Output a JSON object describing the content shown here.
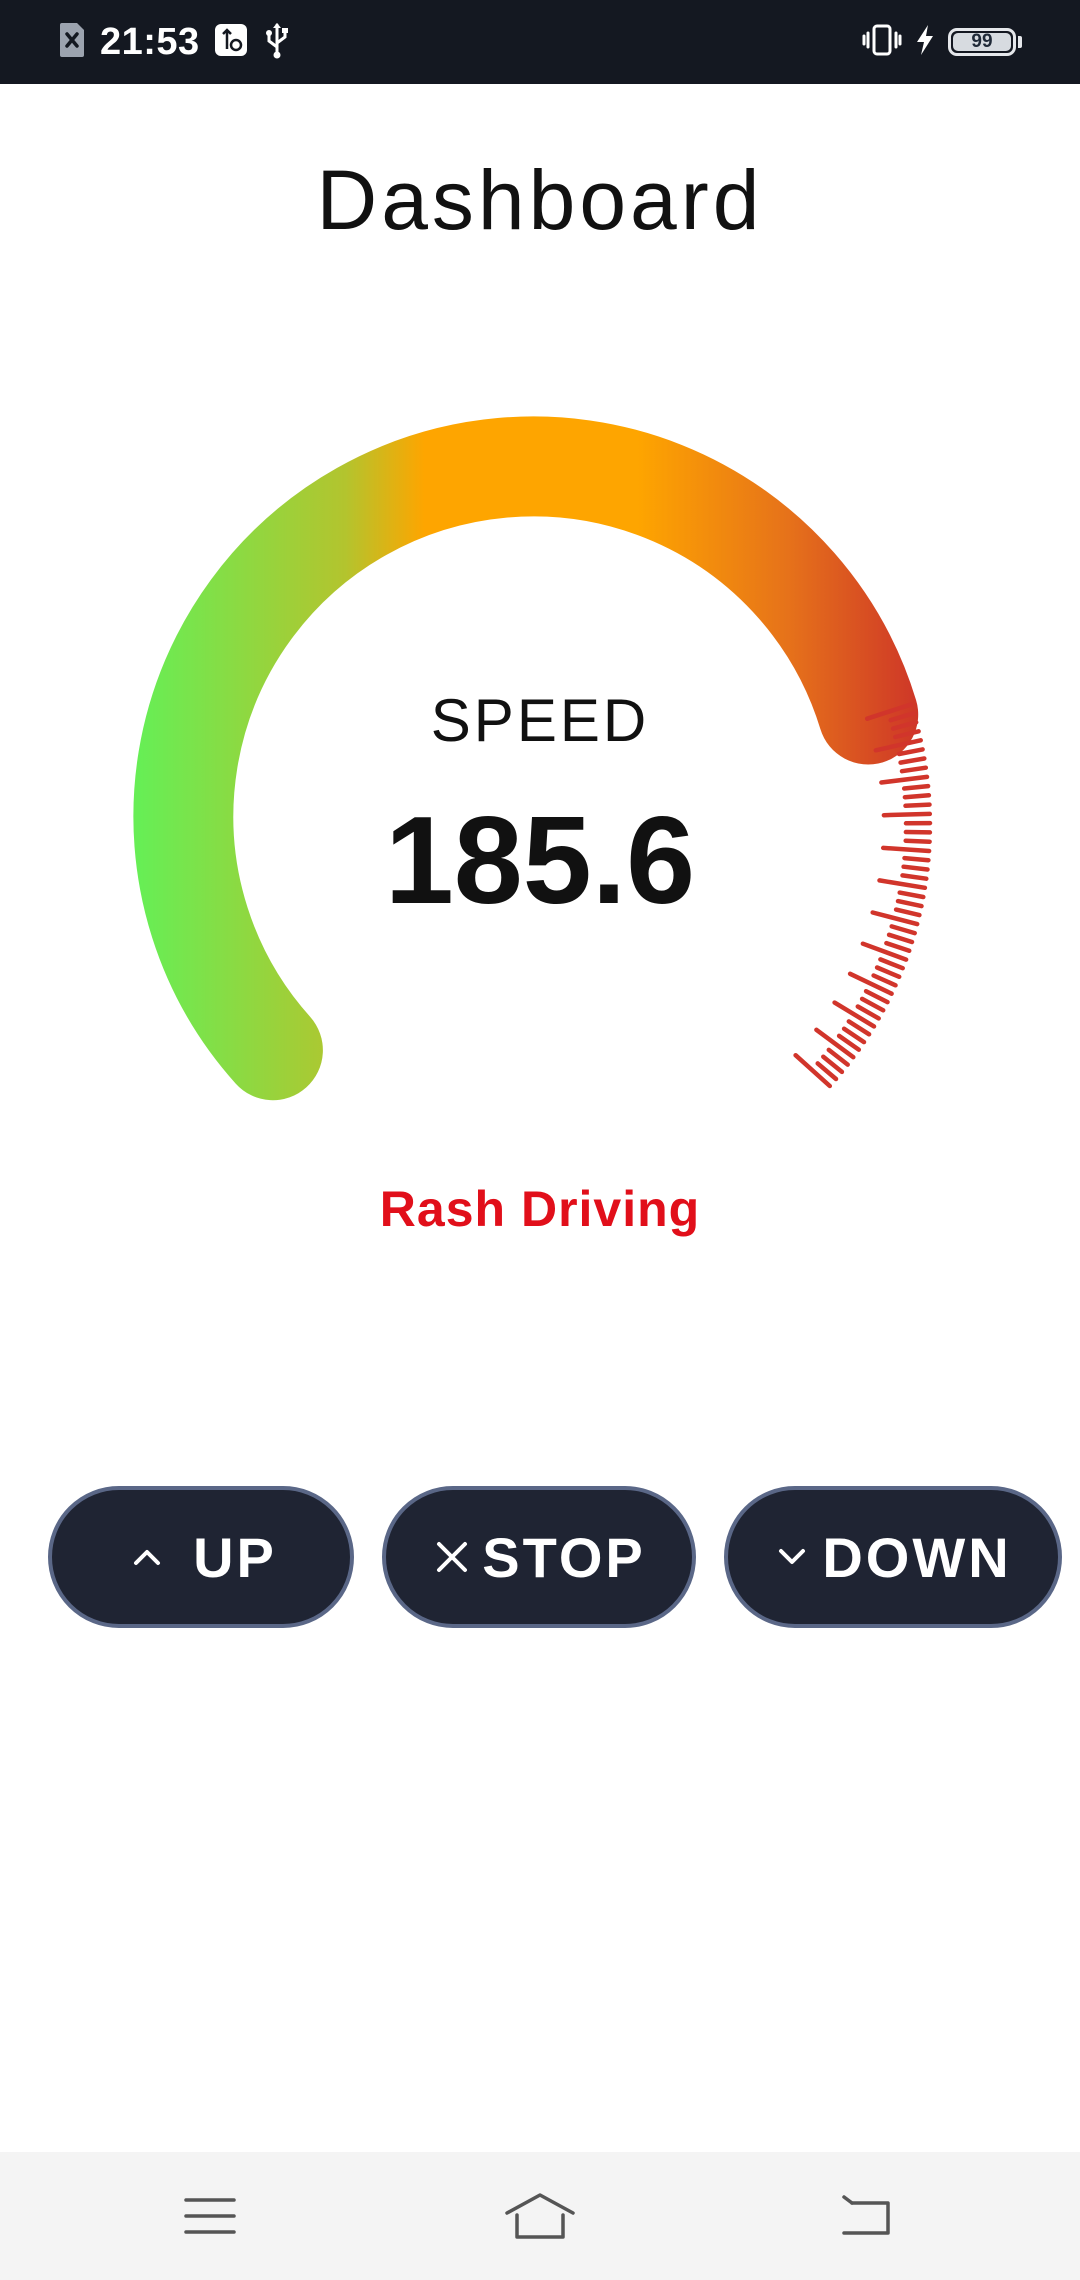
{
  "status_bar": {
    "time": "21:53",
    "battery_level": "99",
    "icons": [
      "sim-blocked-icon",
      "usb-settings-icon",
      "usb-icon",
      "vibrate-icon",
      "charging-icon",
      "battery-icon"
    ]
  },
  "page": {
    "title": "Dashboard"
  },
  "gauge": {
    "label": "SPEED",
    "value": "185.6",
    "status": "Rash Driving",
    "value_fraction": 1.0,
    "colors": {
      "low": "#67ee55",
      "mid": "#fea500",
      "high": "#d1352b",
      "status": "#e10f1a"
    }
  },
  "controls": {
    "up_label": "UP",
    "stop_label": "STOP",
    "down_label": "DOWN",
    "button_bg": "#1f2433",
    "button_border": "#5a6787"
  },
  "nav_bar": {
    "icons": [
      "menu-icon",
      "home-icon",
      "back-icon"
    ]
  }
}
